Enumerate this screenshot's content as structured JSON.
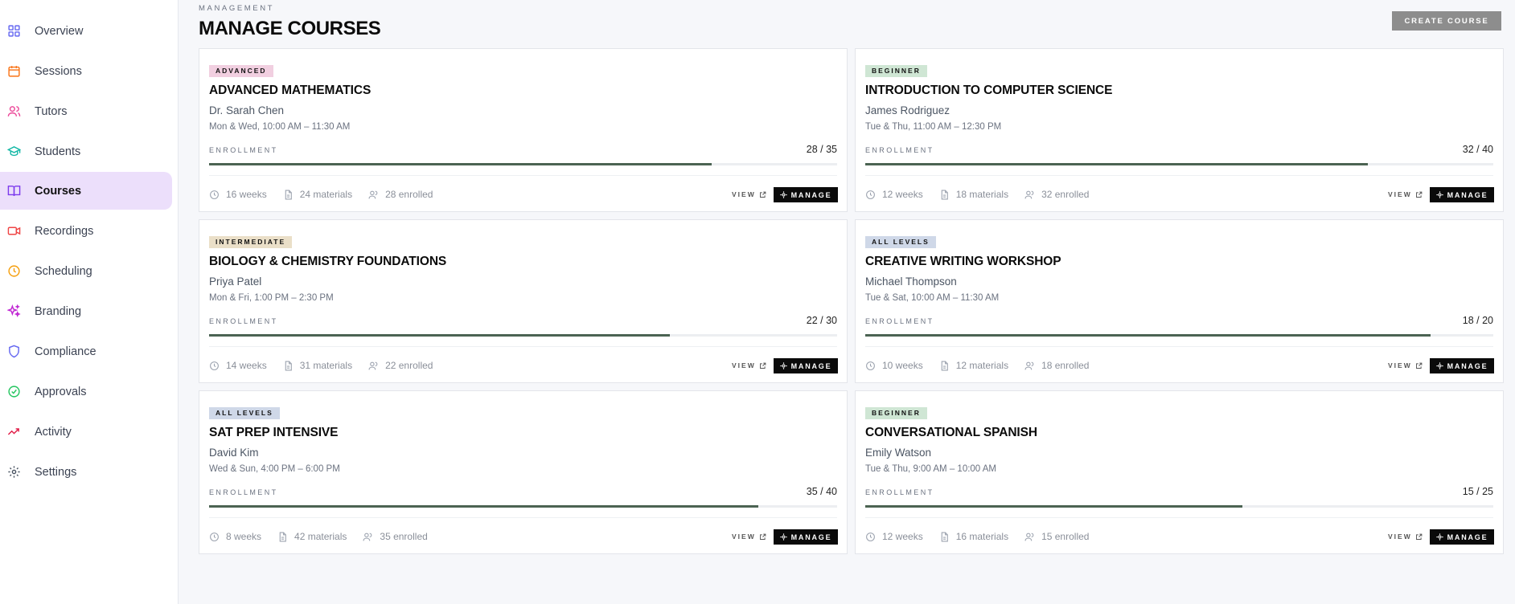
{
  "sidebar": {
    "items": [
      {
        "label": "Overview",
        "icon": "grid-icon",
        "color": "#6366f1"
      },
      {
        "label": "Sessions",
        "icon": "calendar-icon",
        "color": "#f97316"
      },
      {
        "label": "Tutors",
        "icon": "users-icon",
        "color": "#ec4899"
      },
      {
        "label": "Students",
        "icon": "graduation-cap-icon",
        "color": "#14b8a6"
      },
      {
        "label": "Courses",
        "icon": "book-open-icon",
        "color": "#7c3aed",
        "active": true
      },
      {
        "label": "Recordings",
        "icon": "video-icon",
        "color": "#ef4444"
      },
      {
        "label": "Scheduling",
        "icon": "clock-icon",
        "color": "#f59e0b"
      },
      {
        "label": "Branding",
        "icon": "sparkles-icon",
        "color": "#c026d3"
      },
      {
        "label": "Compliance",
        "icon": "shield-icon",
        "color": "#6366f1"
      },
      {
        "label": "Approvals",
        "icon": "check-circle-icon",
        "color": "#22c55e"
      },
      {
        "label": "Activity",
        "icon": "trending-up-icon",
        "color": "#e11d48"
      },
      {
        "label": "Settings",
        "icon": "gear-icon",
        "color": "#4b5563"
      }
    ]
  },
  "header": {
    "eyebrow": "MANAGEMENT",
    "title": "MANAGE COURSES",
    "create_label": "CREATE COURSE"
  },
  "card_labels": {
    "enrollment": "ENROLLMENT",
    "view": "VIEW",
    "manage": "MANAGE"
  },
  "courses": [
    {
      "level": "ADVANCED",
      "level_class": "advanced",
      "title": "ADVANCED MATHEMATICS",
      "instructor": "Dr. Sarah Chen",
      "schedule": "Mon & Wed, 10:00 AM – 11:30 AM",
      "enrolled": 28,
      "capacity": 35,
      "count_text": "28 / 35",
      "weeks": "16 weeks",
      "materials": "24 materials",
      "enrolled_text": "28 enrolled"
    },
    {
      "level": "BEGINNER",
      "level_class": "beginner",
      "title": "INTRODUCTION TO COMPUTER SCIENCE",
      "instructor": "James Rodriguez",
      "schedule": "Tue & Thu, 11:00 AM – 12:30 PM",
      "enrolled": 32,
      "capacity": 40,
      "count_text": "32 / 40",
      "weeks": "12 weeks",
      "materials": "18 materials",
      "enrolled_text": "32 enrolled"
    },
    {
      "level": "INTERMEDIATE",
      "level_class": "intermediate",
      "title": "BIOLOGY & CHEMISTRY FOUNDATIONS",
      "instructor": "Priya Patel",
      "schedule": "Mon & Fri, 1:00 PM – 2:30 PM",
      "enrolled": 22,
      "capacity": 30,
      "count_text": "22 / 30",
      "weeks": "14 weeks",
      "materials": "31 materials",
      "enrolled_text": "22 enrolled"
    },
    {
      "level": "ALL LEVELS",
      "level_class": "all-levels",
      "title": "CREATIVE WRITING WORKSHOP",
      "instructor": "Michael Thompson",
      "schedule": "Tue & Sat, 10:00 AM – 11:30 AM",
      "enrolled": 18,
      "capacity": 20,
      "count_text": "18 / 20",
      "weeks": "10 weeks",
      "materials": "12 materials",
      "enrolled_text": "18 enrolled"
    },
    {
      "level": "ALL LEVELS",
      "level_class": "all-levels",
      "title": "SAT PREP INTENSIVE",
      "instructor": "David Kim",
      "schedule": "Wed & Sun, 4:00 PM – 6:00 PM",
      "enrolled": 35,
      "capacity": 40,
      "count_text": "35 / 40",
      "weeks": "8 weeks",
      "materials": "42 materials",
      "enrolled_text": "35 enrolled"
    },
    {
      "level": "BEGINNER",
      "level_class": "beginner",
      "title": "CONVERSATIONAL SPANISH",
      "instructor": "Emily Watson",
      "schedule": "Tue & Thu, 9:00 AM – 10:00 AM",
      "enrolled": 15,
      "capacity": 25,
      "count_text": "15 / 25",
      "weeks": "12 weeks",
      "materials": "16 materials",
      "enrolled_text": "15 enrolled"
    }
  ]
}
